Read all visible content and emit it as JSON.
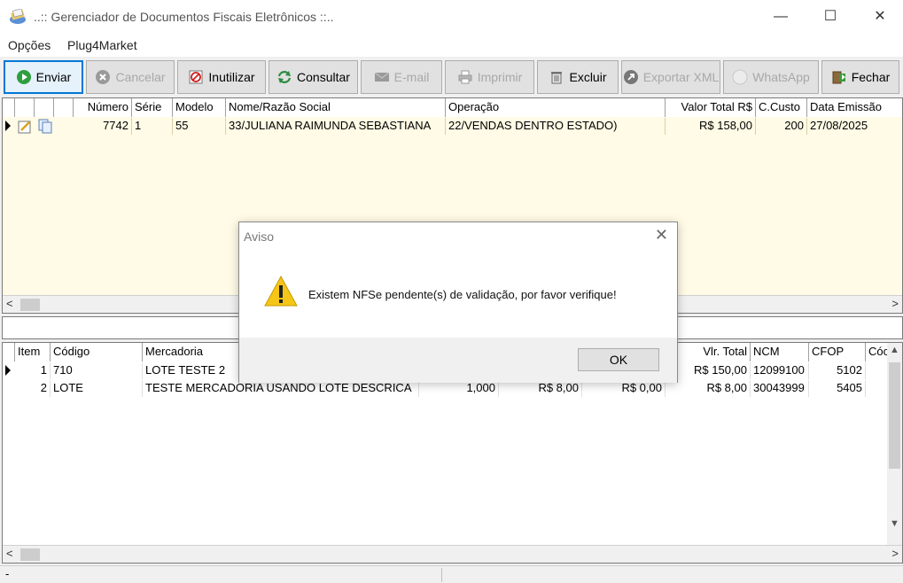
{
  "window": {
    "title": "..:: Gerenciador de Documentos Fiscais Eletrônicos ::..",
    "minimize_glyph": "—",
    "maximize_glyph": "☐",
    "close_glyph": "✕"
  },
  "menu": [
    {
      "label": "Opções"
    },
    {
      "label": "Plug4Market"
    }
  ],
  "toolbar": {
    "buttons": [
      {
        "label": "Enviar",
        "icon": "play-circle-icon",
        "enabled": true,
        "active": true
      },
      {
        "label": "Cancelar",
        "icon": "cancel-circle-icon",
        "enabled": false
      },
      {
        "label": "Inutilizar",
        "icon": "no-entry-icon",
        "enabled": true
      },
      {
        "label": "Consultar",
        "icon": "refresh-arrows-icon",
        "enabled": true
      },
      {
        "label": "E-mail",
        "icon": "envelope-icon",
        "enabled": false
      },
      {
        "label": "Imprimir",
        "icon": "printer-icon",
        "enabled": false
      },
      {
        "label": "Excluir",
        "icon": "trash-icon",
        "enabled": true
      },
      {
        "label": "Exportar XML",
        "icon": "export-icon",
        "enabled": false
      },
      {
        "label": "WhatsApp",
        "icon": "whatsapp-icon",
        "enabled": false
      },
      {
        "label": "Fechar",
        "icon": "exit-door-icon",
        "enabled": true
      }
    ]
  },
  "documents_grid": {
    "columns": [
      "Número",
      "Série",
      "Modelo",
      "Nome/Razão Social",
      "Operação",
      "Valor Total R$",
      "C.Custo",
      "Data Emissão"
    ],
    "rows": [
      {
        "numero": "7742",
        "serie": "1",
        "modelo": "55",
        "nome": "33/JULIANA RAIMUNDA SEBASTIANA",
        "operacao": "22/VENDAS DENTRO ESTADO)",
        "valor_total": "R$ 158,00",
        "c_custo": "200",
        "data_emissao": "27/08/2025"
      }
    ]
  },
  "items_grid": {
    "columns": [
      "Item",
      "Código",
      "Mercadoria",
      "",
      "",
      "",
      "Vlr. Total",
      "NCM",
      "CFOP",
      "Cóc"
    ],
    "rows": [
      {
        "item": "1",
        "codigo": "710",
        "mercadoria": "LOTE TESTE 2",
        "qtd": "",
        "unit": "",
        "desc": "",
        "vlr_total": "R$ 150,00",
        "ncm": "12099100",
        "cfop": "5102"
      },
      {
        "item": "2",
        "codigo": "LOTE",
        "mercadoria": "TESTE MERCADORIA USANDO LOTE DESCRICA",
        "qtd": "1,000",
        "unit": "R$ 8,00",
        "desc": "R$ 0,00",
        "vlr_total": "R$ 8,00",
        "ncm": "30043999",
        "cfop": "5405"
      }
    ]
  },
  "statusbar": {
    "text": "-"
  },
  "dialog": {
    "title": "Aviso",
    "message": "Existem NFSe pendente(s) de validação, por favor verifique!",
    "ok_label": "OK",
    "icon": "warning-icon",
    "close_glyph": "✕"
  }
}
